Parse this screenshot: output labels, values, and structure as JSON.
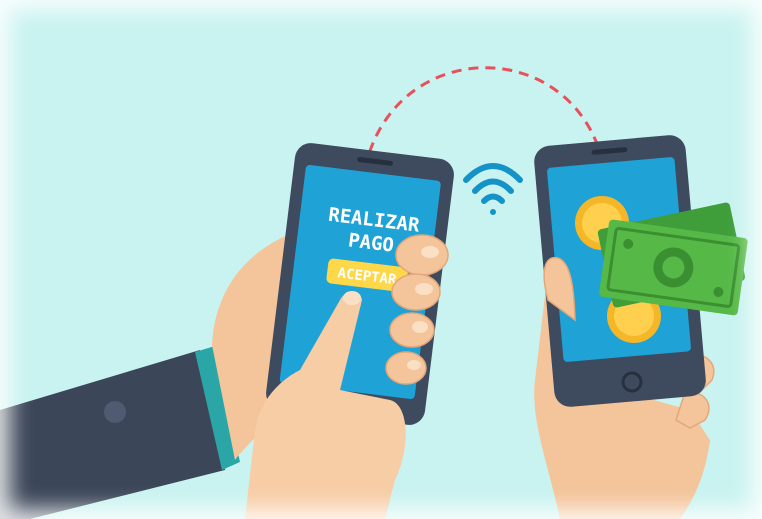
{
  "colors": {
    "background": "#c9f3f0",
    "phone_body": "#3e4a5e",
    "screen": "#1fa2d6",
    "button": "#ffd84a",
    "coin": "#f5b728",
    "cash": "#56b947",
    "skin": "#f4c49a",
    "sleeve": "#3b4658",
    "cuff": "#2ba6a6",
    "arrow": "#e8505b",
    "wifi": "#1592c7"
  },
  "left_phone": {
    "title_line1": "REALIZAR",
    "title_line2": "PAGO",
    "accept_button": "ACEPTAR"
  },
  "icons": {
    "transfer_arrow": "dashed-curved-arrow-icon",
    "wireless": "wifi-icon",
    "coins": "coin-icon",
    "banknotes": "banknote-icon"
  }
}
